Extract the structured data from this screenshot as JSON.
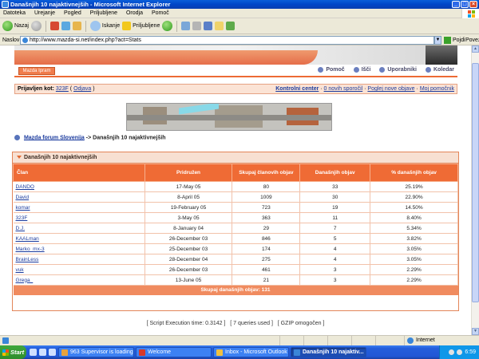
{
  "window": {
    "title": "Današnjih 10 najaktivnejših - Microsoft Internet Explorer"
  },
  "menu": [
    "Datoteka",
    "Urejanje",
    "Pogled",
    "Priljubljene",
    "Orodja",
    "Pomoč"
  ],
  "toolbar": {
    "back": "Nazaj",
    "search": "Iskanje",
    "favorites": "Priljubljene"
  },
  "address": {
    "label": "Naslov",
    "url": "http://www.mazda-si.net/index.php?act=Stats",
    "go": "Pojdi",
    "links": "Povezave"
  },
  "forum": {
    "logo_button": "Mazda Ipram",
    "nav": [
      "Pomoč",
      "Išči",
      "Uporabniki",
      "Koledar"
    ],
    "logged_in_label": "Prijavljen kot:",
    "user": "323F",
    "logout": "Odjava",
    "control_center": "Kontrolni center",
    "new_messages": "0 novih sporočil",
    "new_posts": "Poglej nove objave",
    "assistant": "Moj pomočnik"
  },
  "breadcrumb": {
    "home": "Mazda forum Slovenija",
    "sep": "->",
    "current": "Današnjih 10 najaktivnejših"
  },
  "stats": {
    "title": "Današnjih 10 najaktivnejših",
    "columns": [
      "Član",
      "Pridružen",
      "Skupaj članovih objav",
      "Današnjih objav",
      "% današnjih objav"
    ],
    "rows": [
      [
        "DANDO",
        "17-May 05",
        "80",
        "33",
        "25.19%"
      ],
      [
        "David",
        "8-April 05",
        "1009",
        "30",
        "22.90%"
      ],
      [
        "komar",
        "19-February 05",
        "723",
        "19",
        "14.50%"
      ],
      [
        "323F",
        "3-May 05",
        "363",
        "11",
        "8.40%"
      ],
      [
        "D.J.",
        "8-January 04",
        "29",
        "7",
        "5.34%"
      ],
      [
        "KAALman",
        "26-December 03",
        "846",
        "5",
        "3.82%"
      ],
      [
        "Marko_mx-3",
        "25-December 03",
        "174",
        "4",
        "3.05%"
      ],
      [
        "BrainLess",
        "28-December 04",
        "275",
        "4",
        "3.05%"
      ],
      [
        "vuk",
        "26-December 03",
        "461",
        "3",
        "2.29%"
      ],
      [
        "Grega_",
        "13-June 05",
        "21",
        "3",
        "2.29%"
      ]
    ],
    "total": "Skupaj današnjih objav: 131"
  },
  "footer": "[ Script Execution time: 0.3142 ]   [ 7 queries used ]   [ GZIP omogočen ]",
  "status": {
    "zone": "Internet"
  },
  "taskbar": {
    "start": "Start",
    "tasks": [
      {
        "label": "963 Supervisor is loading...",
        "color": "#e8a23c"
      },
      {
        "label": "Welcome",
        "color": "#d8392a"
      },
      {
        "label": "Inbox - Microsoft Outlook",
        "color": "#f0c040"
      },
      {
        "label": "Današnjih 10 najaktiv...",
        "color": "#3a86d8"
      }
    ],
    "clock": "6:59"
  }
}
